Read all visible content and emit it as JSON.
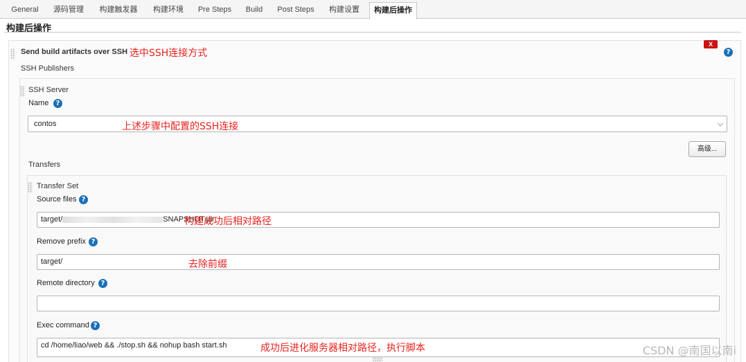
{
  "tabs": [
    {
      "label": "General",
      "active": false
    },
    {
      "label": "源码管理",
      "active": false
    },
    {
      "label": "构建触发器",
      "active": false
    },
    {
      "label": "构建环境",
      "active": false
    },
    {
      "label": "Pre Steps",
      "active": false
    },
    {
      "label": "Build",
      "active": false
    },
    {
      "label": "Post Steps",
      "active": false
    },
    {
      "label": "构建设置",
      "active": false
    },
    {
      "label": "构建后操作",
      "active": true
    }
  ],
  "section_title": "构建后操作",
  "publisher": {
    "title": "Send build artifacts over SSH",
    "delete_label": "X",
    "help_icon": "question-circle-icon",
    "publishers_label": "SSH Publishers"
  },
  "server": {
    "heading": "SSH Server",
    "name_label": "Name",
    "name_value": "contos",
    "advanced_button": "高级..."
  },
  "transfers": {
    "label": "Transfers",
    "set_heading": "Transfer Set",
    "source_files_label": "Source files",
    "source_files_value_prefix": "target/",
    "source_files_value_suffix": "SNAPSHOT.jar",
    "remove_prefix_label": "Remove prefix",
    "remove_prefix_value": "target/",
    "remote_directory_label": "Remote directory",
    "remote_directory_value": "",
    "exec_command_label": "Exec command",
    "exec_command_value": "cd /home/liao/web && ./stop.sh && nohup bash start.sh"
  },
  "annotations": {
    "ssh_method": "选中SSH连接方式",
    "ssh_config": "上述步骤中配置的SSH连接",
    "relative_path": "构建成功后相对路径",
    "remove_prefix": "去除前缀",
    "exec_script": "成功后进化服务器相对路径，执行脚本"
  },
  "watermark": "CSDN @南国以南i",
  "colors": {
    "annotation": "#e8231e",
    "help": "#1a6fb8",
    "delete": "#cc1111"
  }
}
